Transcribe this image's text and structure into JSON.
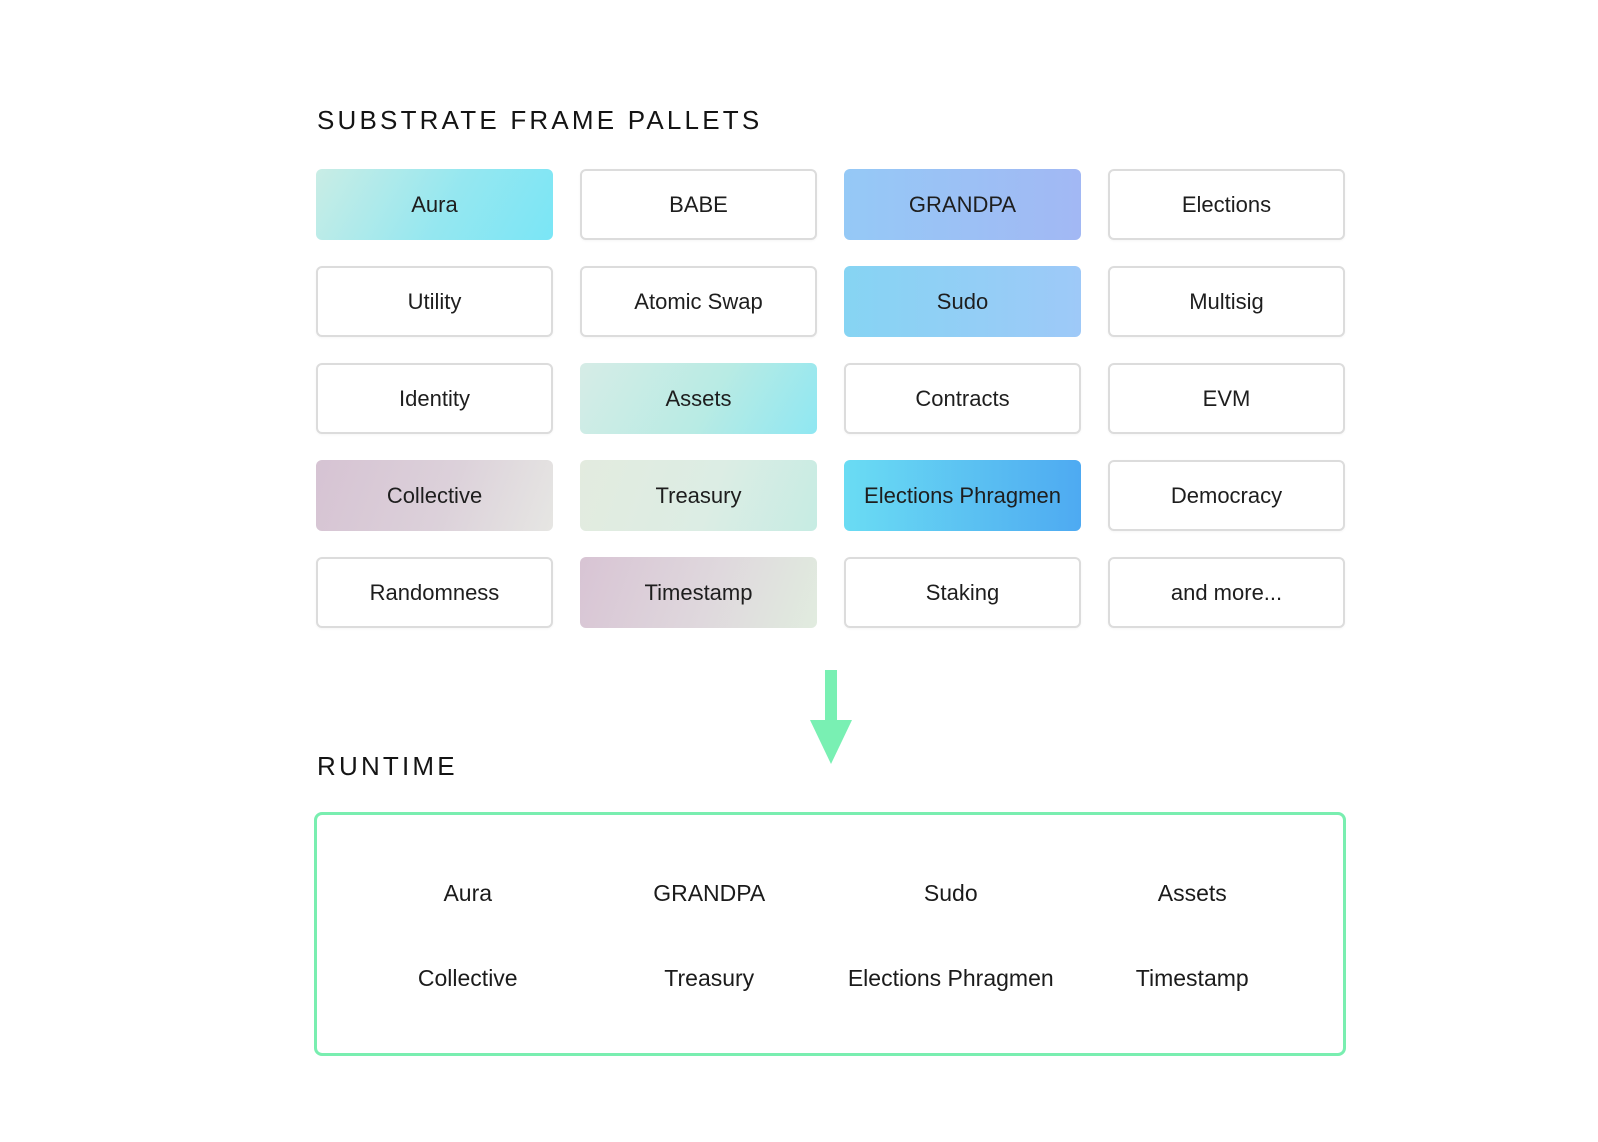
{
  "pallets_title": "SUBSTRATE FRAME PALLETS",
  "pallets": [
    {
      "label": "Aura",
      "style": "aqua"
    },
    {
      "label": "BABE",
      "style": "outline"
    },
    {
      "label": "GRANDPA",
      "style": "blue"
    },
    {
      "label": "Elections",
      "style": "outline"
    },
    {
      "label": "Utility",
      "style": "outline"
    },
    {
      "label": "Atomic Swap",
      "style": "outline"
    },
    {
      "label": "Sudo",
      "style": "sky"
    },
    {
      "label": "Multisig",
      "style": "outline"
    },
    {
      "label": "Identity",
      "style": "outline"
    },
    {
      "label": "Assets",
      "style": "mint"
    },
    {
      "label": "Contracts",
      "style": "outline"
    },
    {
      "label": "EVM",
      "style": "outline"
    },
    {
      "label": "Collective",
      "style": "mauve"
    },
    {
      "label": "Treasury",
      "style": "sage"
    },
    {
      "label": "Elections Phragmen",
      "style": "bright"
    },
    {
      "label": "Democracy",
      "style": "outline"
    },
    {
      "label": "Randomness",
      "style": "outline"
    },
    {
      "label": "Timestamp",
      "style": "dusk"
    },
    {
      "label": "Staking",
      "style": "outline"
    },
    {
      "label": "and more...",
      "style": "outline"
    }
  ],
  "runtime_title": "RUNTIME",
  "runtime_items": [
    "Aura",
    "GRANDPA",
    "Sudo",
    "Assets",
    "Collective",
    "Treasury",
    "Elections Phragmen",
    "Timestamp"
  ],
  "colors": {
    "arrow": "#79f0b3",
    "runtime_border": "#79eeb0",
    "outline_border": "#dcdcdc"
  }
}
